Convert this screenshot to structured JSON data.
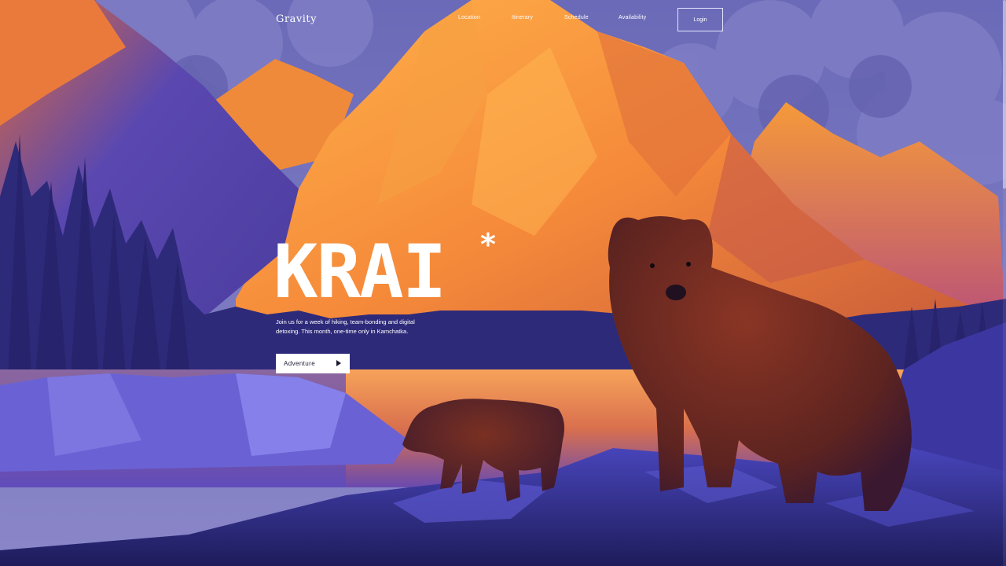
{
  "header": {
    "logo": "Gravity",
    "nav": [
      "Location",
      "Itinerary",
      "Schedule",
      "Availability"
    ],
    "login_label": "Login"
  },
  "hero": {
    "title": "KRAI",
    "asterisk": "*",
    "description": "Join us for a week of hiking, team-bonding and digital detoxing. This month, one-time only in Kamchatka.",
    "cta_label": "Adventure"
  },
  "colors": {
    "sky_cloud": "#5f5fb0",
    "mountain_orange": "#f08a2e",
    "mountain_purple": "#4a3f9c",
    "lake": "#e7874a",
    "rock_blue": "#4a45b8",
    "bear_brown": "#6b2a20"
  },
  "icons": [
    "play-icon"
  ]
}
